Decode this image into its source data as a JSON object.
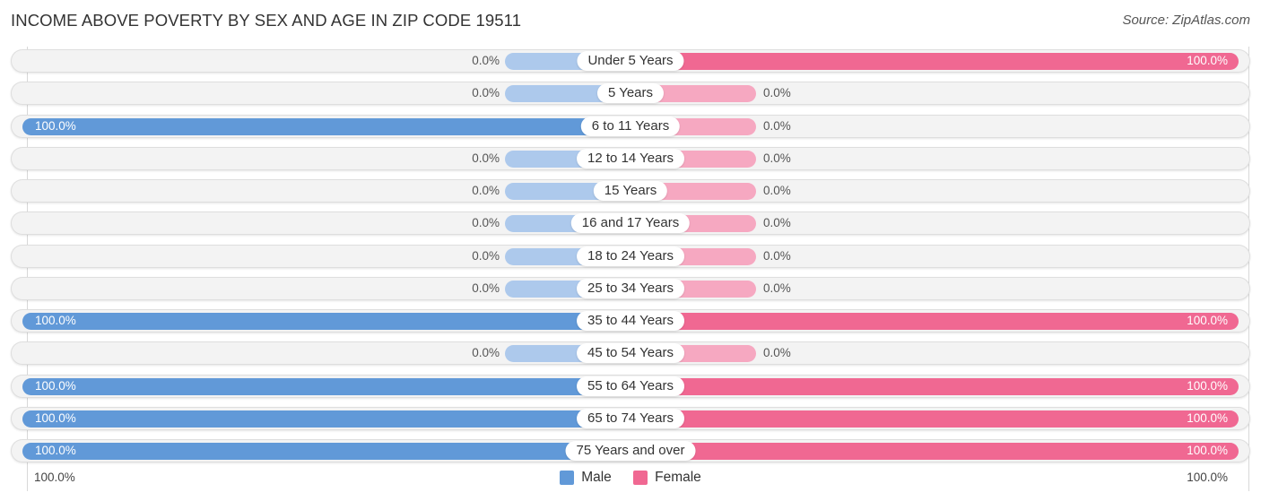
{
  "title": "INCOME ABOVE POVERTY BY SEX AND AGE IN ZIP CODE 19511",
  "source": "Source: ZipAtlas.com",
  "colors": {
    "male": "#6199d8",
    "male_zero": "#adc9ec",
    "female": "#f06892",
    "female_zero": "#f6a8c1"
  },
  "legend": [
    {
      "label": "Male",
      "color": "#6199d8"
    },
    {
      "label": "Female",
      "color": "#f06892"
    }
  ],
  "bottom_axis": {
    "left": "100.0%",
    "right": "100.0%"
  },
  "chart_data": {
    "type": "bar",
    "orientation": "horizontal-diverging",
    "title": "INCOME ABOVE POVERTY BY SEX AND AGE IN ZIP CODE 19511",
    "xlabel": "",
    "ylabel": "",
    "xlim": [
      0,
      100
    ],
    "unit": "%",
    "legend_position": "bottom-center",
    "grid": false,
    "categories": [
      "Under 5 Years",
      "5 Years",
      "6 to 11 Years",
      "12 to 14 Years",
      "15 Years",
      "16 and 17 Years",
      "18 to 24 Years",
      "25 to 34 Years",
      "35 to 44 Years",
      "45 to 54 Years",
      "55 to 64 Years",
      "65 to 74 Years",
      "75 Years and over"
    ],
    "series": [
      {
        "name": "Male",
        "values": [
          0.0,
          0.0,
          100.0,
          0.0,
          0.0,
          0.0,
          0.0,
          0.0,
          100.0,
          0.0,
          100.0,
          100.0,
          100.0
        ],
        "labels": [
          "0.0%",
          "0.0%",
          "100.0%",
          "0.0%",
          "0.0%",
          "0.0%",
          "0.0%",
          "0.0%",
          "100.0%",
          "0.0%",
          "100.0%",
          "100.0%",
          "100.0%"
        ]
      },
      {
        "name": "Female",
        "values": [
          100.0,
          0.0,
          0.0,
          0.0,
          0.0,
          0.0,
          0.0,
          0.0,
          100.0,
          0.0,
          100.0,
          100.0,
          100.0
        ],
        "labels": [
          "100.0%",
          "0.0%",
          "0.0%",
          "0.0%",
          "0.0%",
          "0.0%",
          "0.0%",
          "0.0%",
          "100.0%",
          "0.0%",
          "100.0%",
          "100.0%",
          "100.0%"
        ]
      }
    ]
  }
}
